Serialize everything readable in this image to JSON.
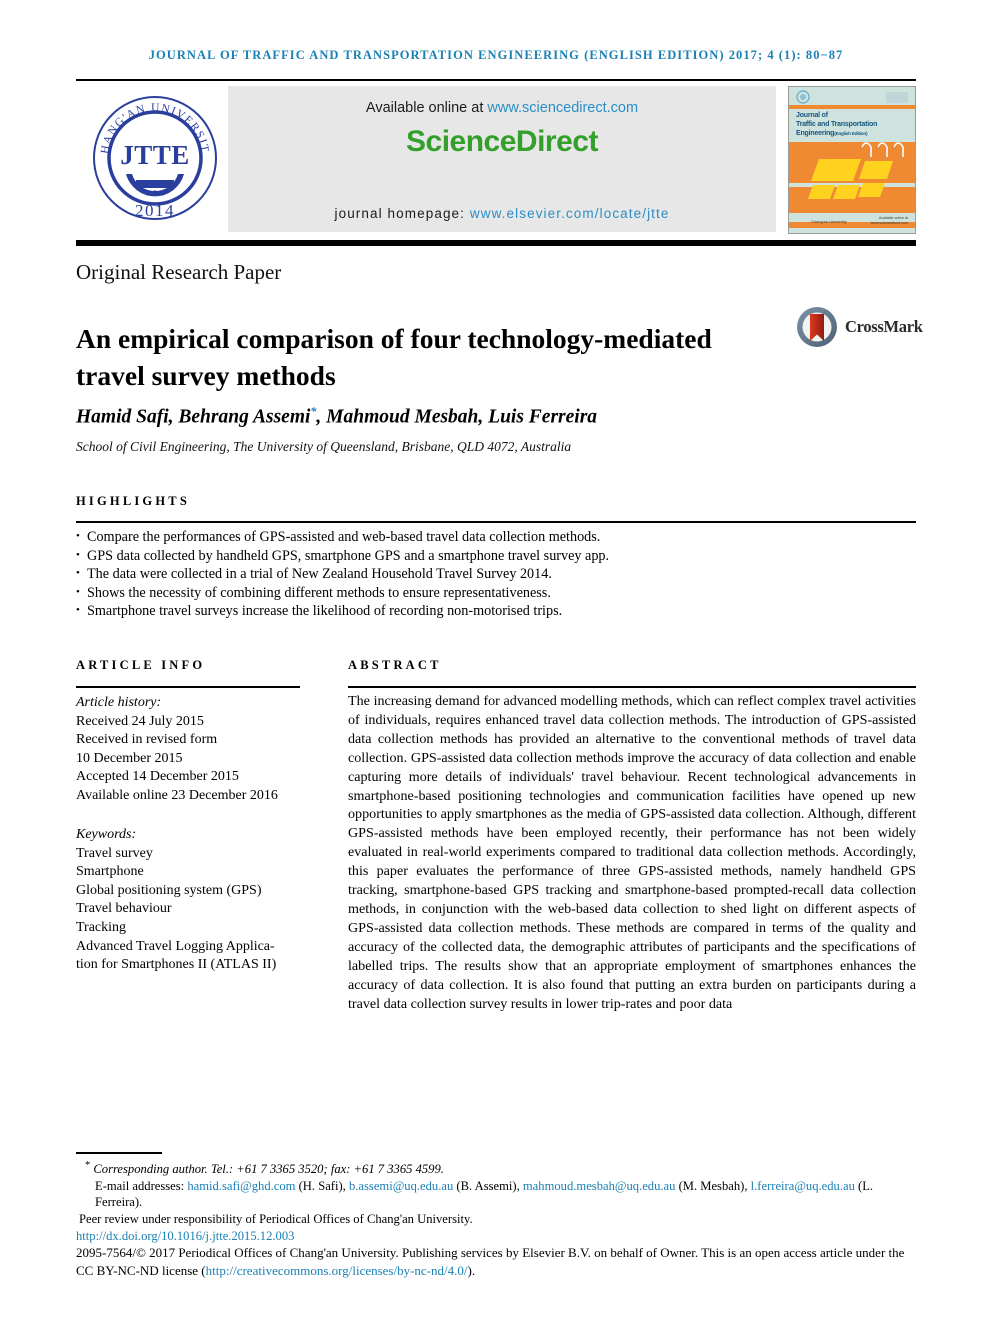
{
  "running_head": "JOURNAL OF TRAFFIC AND TRANSPORTATION ENGINEERING (ENGLISH EDITION) 2017; 4 (1): 80−87",
  "masthead": {
    "logo": {
      "ring_text": "CHANG'AN UNIVERSITY",
      "acronym": "JTTE",
      "year": "2014"
    },
    "available_prefix": "Available online at ",
    "available_link": "www.sciencedirect.com",
    "sciencedirect": "ScienceDirect",
    "homepage_prefix": "journal homepage: ",
    "homepage_link": "www.elsevier.com/locate/jtte",
    "cover": {
      "line1": "Journal of",
      "line2": "Traffic and Transportation",
      "line3": "Engineering",
      "line3_sub": "(English Edition)",
      "bottom_left": "Chang'an University",
      "bottom_right": "Available online at\nwww.sciencedirect.com"
    }
  },
  "article_type": "Original Research Paper",
  "title": "An empirical comparison of four technology-mediated travel survey methods",
  "crossmark": "CrossMark",
  "authors": "Hamid Safi, Behrang Assemi",
  "authors_tail": ", Mahmoud Mesbah, Luis Ferreira",
  "author_marker": "*",
  "affiliation": "School of Civil Engineering, The University of Queensland, Brisbane, QLD 4072, Australia",
  "highlights": {
    "label": "HIGHLIGHTS",
    "items": [
      "Compare the performances of GPS-assisted and web-based travel data collection methods.",
      "GPS data collected by handheld GPS, smartphone GPS and a smartphone travel survey app.",
      "The data were collected in a trial of New Zealand Household Travel Survey 2014.",
      "Shows the necessity of combining different methods to ensure representativeness.",
      "Smartphone travel surveys increase the likelihood of recording non-motorised trips."
    ]
  },
  "article_info": {
    "label": "ARTICLE INFO",
    "history_header": "Article history:",
    "history": [
      "Received 24 July 2015",
      "Received in revised form",
      "10 December 2015",
      "Accepted 14 December 2015",
      "Available online 23 December 2016"
    ],
    "keywords_header": "Keywords:",
    "keywords": [
      "Travel survey",
      "Smartphone",
      "Global positioning system (GPS)",
      "Travel behaviour",
      "Tracking",
      "Advanced Travel Logging Applica-",
      "tion for Smartphones II (ATLAS II)"
    ]
  },
  "abstract": {
    "label": "ABSTRACT",
    "text": "The increasing demand for advanced modelling methods, which can reflect complex travel activities of individuals, requires enhanced travel data collection methods. The introduction of GPS-assisted data collection methods has provided an alternative to the conventional methods of travel data collection. GPS-assisted data collection methods improve the accuracy of data collection and enable capturing more details of individuals' travel behaviour. Recent technological advancements in smartphone-based positioning technologies and communication facilities have opened up new opportunities to apply smartphones as the media of GPS-assisted data collection. Although, different GPS-assisted methods have been employed recently, their performance has not been widely evaluated in real-world experiments compared to traditional data collection methods. Accordingly, this paper evaluates the performance of three GPS-assisted methods, namely handheld GPS tracking, smartphone-based GPS tracking and smartphone-based prompted-recall data collection methods, in conjunction with the web-based data collection to shed light on different aspects of GPS-assisted data collection methods. These methods are compared in terms of the quality and accuracy of the collected data, the demographic attributes of participants and the specifications of labelled trips. The results show that an appropriate employment of smartphones enhances the accuracy of data collection. It is also found that putting an extra burden on participants during a travel data collection survey results in lower trip-rates and poor data"
  },
  "footnotes": {
    "corresponding": "Corresponding author. Tel.: +61 7 3365 3520; fax: +61 7 3365 4599.",
    "corresponding_marker": "*",
    "emails_label": "E-mail addresses: ",
    "emails": [
      {
        "address": "hamid.safi@ghd.com",
        "name": " (H. Safi), "
      },
      {
        "address": "b.assemi@uq.edu.au",
        "name": " (B. Assemi), "
      },
      {
        "address": "mahmoud.mesbah@uq.edu.au",
        "name": " (M. Mesbah), "
      },
      {
        "address": "l.ferreira@uq.edu.au",
        "name": " (L. Ferreira)."
      }
    ],
    "peer_review": "Peer review under responsibility of Periodical Offices of Chang'an University.",
    "doi": "http://dx.doi.org/10.1016/j.jtte.2015.12.003"
  },
  "copyright": {
    "line1": "2095-7564/© 2017 Periodical Offices of Chang'an University. Publishing services by Elsevier B.V. on behalf of Owner. This is an open",
    "line2_pre": "access article under the CC BY-NC-ND license (",
    "license_link": "http://creativecommons.org/licenses/by-nc-nd/4.0/",
    "line2_post": ")."
  },
  "colors": {
    "link": "#1a7fb5",
    "sciencedirect_green": "#33a02c",
    "seal_blue": "#2a3f9d",
    "cover_teal": "#cfe3de",
    "cover_orange": "#ef8a33",
    "cover_yellow": "#ffd21f"
  }
}
